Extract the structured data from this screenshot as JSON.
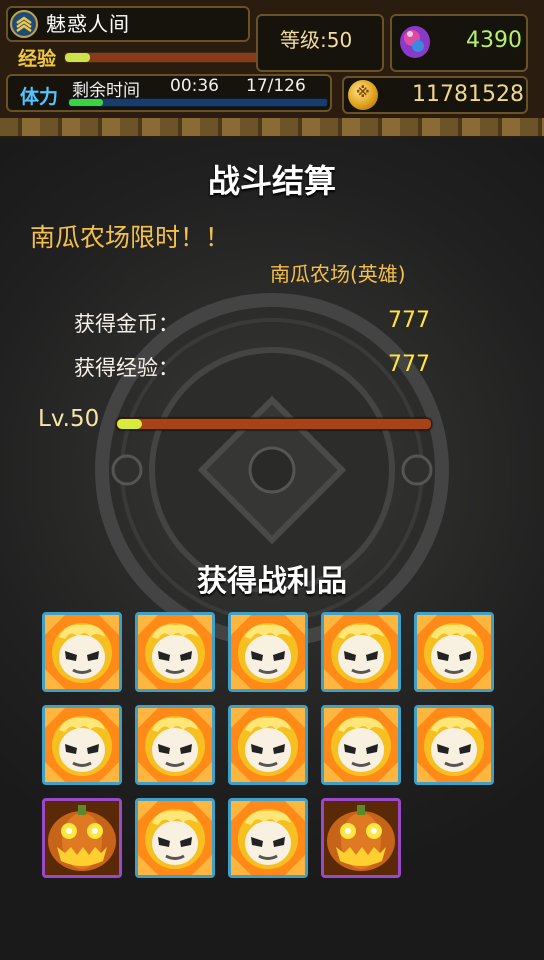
{
  "hud": {
    "player_name": "魅惑人间",
    "level_text": "等级:50",
    "exp_label": "经验",
    "exp_progress": 0.08,
    "gems": "4390",
    "stamina_label": "体力",
    "stamina_time_label": "剩余时间",
    "stamina_time": "00:36",
    "stamina_count": "17/126",
    "stamina_progress": 0.13,
    "gold": "11781528",
    "coin_icon": "coin-icon"
  },
  "result": {
    "title": "战斗结算",
    "event": "南瓜农场限时！！",
    "stage": "南瓜农场(英雄)",
    "gold_label": "获得金币：",
    "gold_value": "777",
    "exp_label": "获得经验：",
    "exp_value": "777",
    "level": "Lv.50",
    "level_progress": 0.08
  },
  "loot": {
    "title": "获得战利品",
    "items": [
      {
        "type": "ghost-pumpkin",
        "rarity": "blue"
      },
      {
        "type": "ghost-pumpkin",
        "rarity": "blue"
      },
      {
        "type": "ghost-pumpkin",
        "rarity": "blue"
      },
      {
        "type": "ghost-pumpkin",
        "rarity": "blue"
      },
      {
        "type": "ghost-pumpkin",
        "rarity": "blue"
      },
      {
        "type": "ghost-pumpkin",
        "rarity": "blue"
      },
      {
        "type": "ghost-pumpkin",
        "rarity": "blue"
      },
      {
        "type": "ghost-pumpkin",
        "rarity": "blue"
      },
      {
        "type": "ghost-pumpkin",
        "rarity": "blue"
      },
      {
        "type": "ghost-pumpkin",
        "rarity": "blue"
      },
      {
        "type": "jack-o-lantern",
        "rarity": "purple"
      },
      {
        "type": "ghost-pumpkin",
        "rarity": "blue"
      },
      {
        "type": "ghost-pumpkin",
        "rarity": "blue"
      },
      {
        "type": "jack-o-lantern",
        "rarity": "purple"
      }
    ]
  },
  "colors": {
    "gold_text": "#f4c04a",
    "value_yellow": "#ffe640",
    "blue_border": "#3fa0c8",
    "purple_border": "#9a4ac8"
  }
}
